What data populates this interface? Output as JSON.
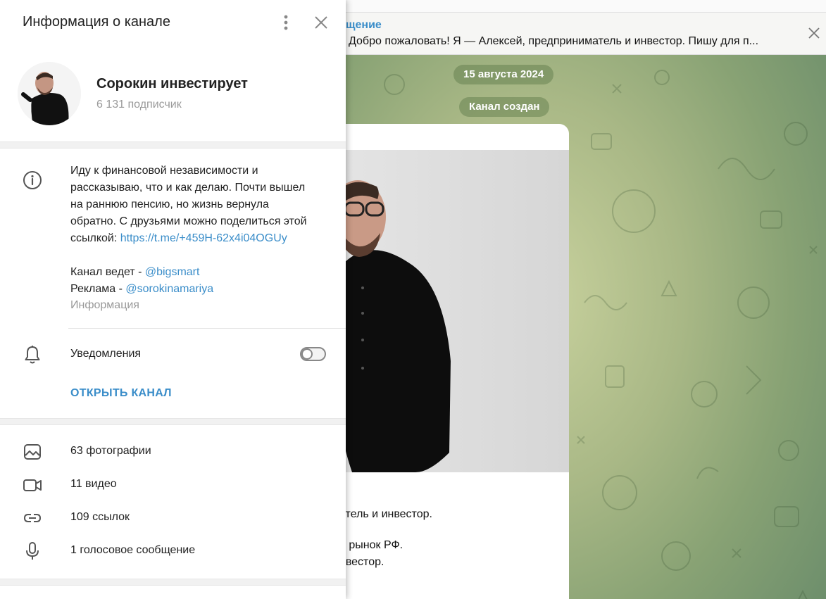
{
  "pinned": {
    "title": "щение",
    "text": "Добро пожаловать! Я — Алексей, предприниматель и инвестор.  Пишу для п..."
  },
  "chat": {
    "date_pill": "15 августа 2024",
    "created_pill": "Канал создан",
    "post_lines": [
      "атель и инвестор.",
      "й рынок РФ.",
      "нвестор."
    ]
  },
  "panel": {
    "title": "Информация о канале",
    "channel_name": "Сорокин инвестирует",
    "subscribers": "6 131 подписчик",
    "description": {
      "line1": "Иду к финансовой независимости и",
      "line2": "рассказываю, что и как делаю. Почти вышел",
      "line3": "на раннюю пенсию, но жизнь вернула",
      "line4": "обратно. С друзьями можно поделиться этой",
      "line5_prefix": "ссылкой: ",
      "invite_link": "https://t.me/+459H-62x4i04OGUy",
      "admin_prefix": "Канал ведет - ",
      "admin_handle": "@bigsmart",
      "ads_prefix": "Реклама - ",
      "ads_handle": "@sorokinamariya"
    },
    "description_caption": "Информация",
    "notifications_label": "Уведомления",
    "notifications_enabled": false,
    "open_channel_label": "ОТКРЫТЬ КАНАЛ",
    "media": [
      {
        "label": "63 фотографии",
        "icon": "photo-icon"
      },
      {
        "label": "11 видео",
        "icon": "video-icon"
      },
      {
        "label": "109 ссылок",
        "icon": "link-icon"
      },
      {
        "label": "1 голосовое сообщение",
        "icon": "microphone-icon"
      }
    ]
  },
  "colors": {
    "accent": "#3a8dc9",
    "panel_bg": "#ffffff",
    "secondary_text": "#999999"
  }
}
